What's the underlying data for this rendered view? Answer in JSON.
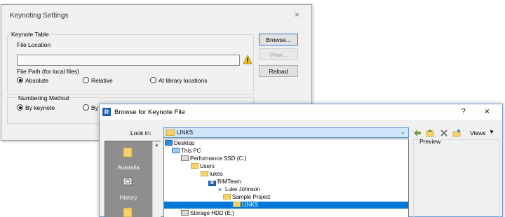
{
  "keynoting": {
    "title": "Keynoting Settings",
    "close": "×",
    "group_title": "Keynote Table",
    "file_location_label": "File Location",
    "file_location_value": "",
    "buttons": {
      "browse": "Browse...",
      "view": "View...",
      "reload": "Reload"
    },
    "file_path_label": "File Path (for local files)",
    "path_options": [
      "Absolute",
      "Relative",
      "At library locations"
    ],
    "path_selected": "Absolute",
    "numbering_label": "Numbering Method",
    "numbering_options": [
      "By keynote",
      "By"
    ],
    "numbering_selected": "By keynote"
  },
  "browse": {
    "title": "Browse for Keynote File",
    "app_icon": "R",
    "help": "?",
    "close": "×",
    "look_in_label": "Look in:",
    "look_in_value": "LINKS",
    "toolbar_icons": [
      "back-icon",
      "up-folder-icon",
      "delete-icon",
      "new-folder-icon"
    ],
    "views_label": "Views",
    "preview_label": "Preview",
    "places": [
      "Australia",
      "History"
    ],
    "tree": [
      {
        "label": "Desktop",
        "icon": "desktop-icon"
      },
      {
        "label": "This PC",
        "icon": "pc-icon"
      },
      {
        "label": "Performance SSD (C:)",
        "icon": "drive-icon"
      },
      {
        "label": "Users",
        "icon": "folder-icon"
      },
      {
        "label": "lukes",
        "icon": "folder-icon"
      },
      {
        "label": "BIMTeam",
        "icon": "bim-icon"
      },
      {
        "label": "Luke Johnson",
        "icon": "user-icon"
      },
      {
        "label": "Sample Project",
        "icon": "folder-icon"
      },
      {
        "label": "LINKS",
        "icon": "folder-icon",
        "selected": true
      },
      {
        "label": "Storage HDD (E:)",
        "icon": "drive-icon"
      }
    ]
  }
}
